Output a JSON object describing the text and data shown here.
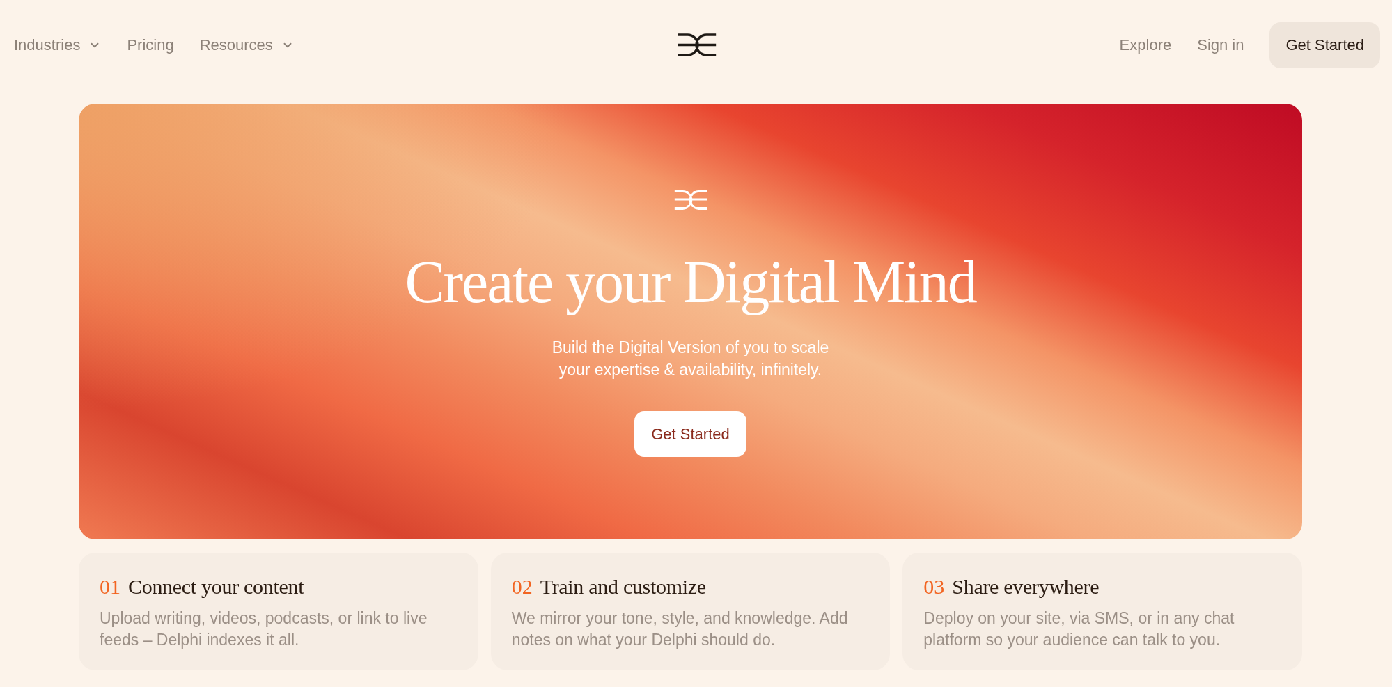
{
  "nav": {
    "left_items": [
      {
        "label": "Industries",
        "kind": "dropdown"
      },
      {
        "label": "Pricing",
        "kind": "link"
      },
      {
        "label": "Resources",
        "kind": "dropdown"
      }
    ],
    "right_items": [
      {
        "label": "Explore",
        "kind": "link"
      },
      {
        "label": "Sign in",
        "kind": "link"
      },
      {
        "label": "Get Started",
        "kind": "button"
      }
    ]
  },
  "hero": {
    "title": "Create your Digital Mind",
    "subtitle": "Build the Digital Version of you to scale your expertise & availability, infinitely.",
    "button": "Get Started"
  },
  "steps": [
    {
      "number": "01",
      "title": "Connect your content",
      "description": "Upload writing, videos, podcasts, or link to live feeds – Delphi indexes it all."
    },
    {
      "number": "02",
      "title": "Train and customize",
      "description": "We mirror your tone, style, and knowledge. Add notes on what your Delphi should do."
    },
    {
      "number": "03",
      "title": "Share everywhere",
      "description": "Deploy on your site, via SMS, or in any chat platform so your audience can talk to you."
    }
  ]
}
